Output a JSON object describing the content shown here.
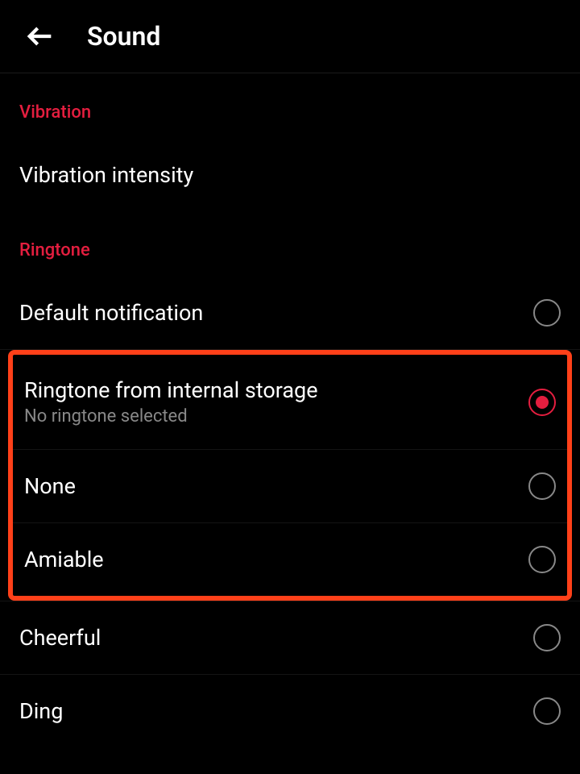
{
  "colors": {
    "accent": "#e41e3f",
    "highlight_border": "#ff4019"
  },
  "header": {
    "title": "Sound"
  },
  "sections": {
    "vibration": {
      "title": "Vibration",
      "items": [
        {
          "label": "Vibration intensity"
        }
      ]
    },
    "ringtone": {
      "title": "Ringtone",
      "options": [
        {
          "label": "Default notification",
          "sublabel": "",
          "selected": false
        },
        {
          "label": "Ringtone from internal storage",
          "sublabel": "No ringtone selected",
          "selected": true
        },
        {
          "label": "None",
          "sublabel": "",
          "selected": false
        },
        {
          "label": "Amiable",
          "sublabel": "",
          "selected": false
        },
        {
          "label": "Cheerful",
          "sublabel": "",
          "selected": false
        },
        {
          "label": "Ding",
          "sublabel": "",
          "selected": false
        }
      ]
    }
  }
}
